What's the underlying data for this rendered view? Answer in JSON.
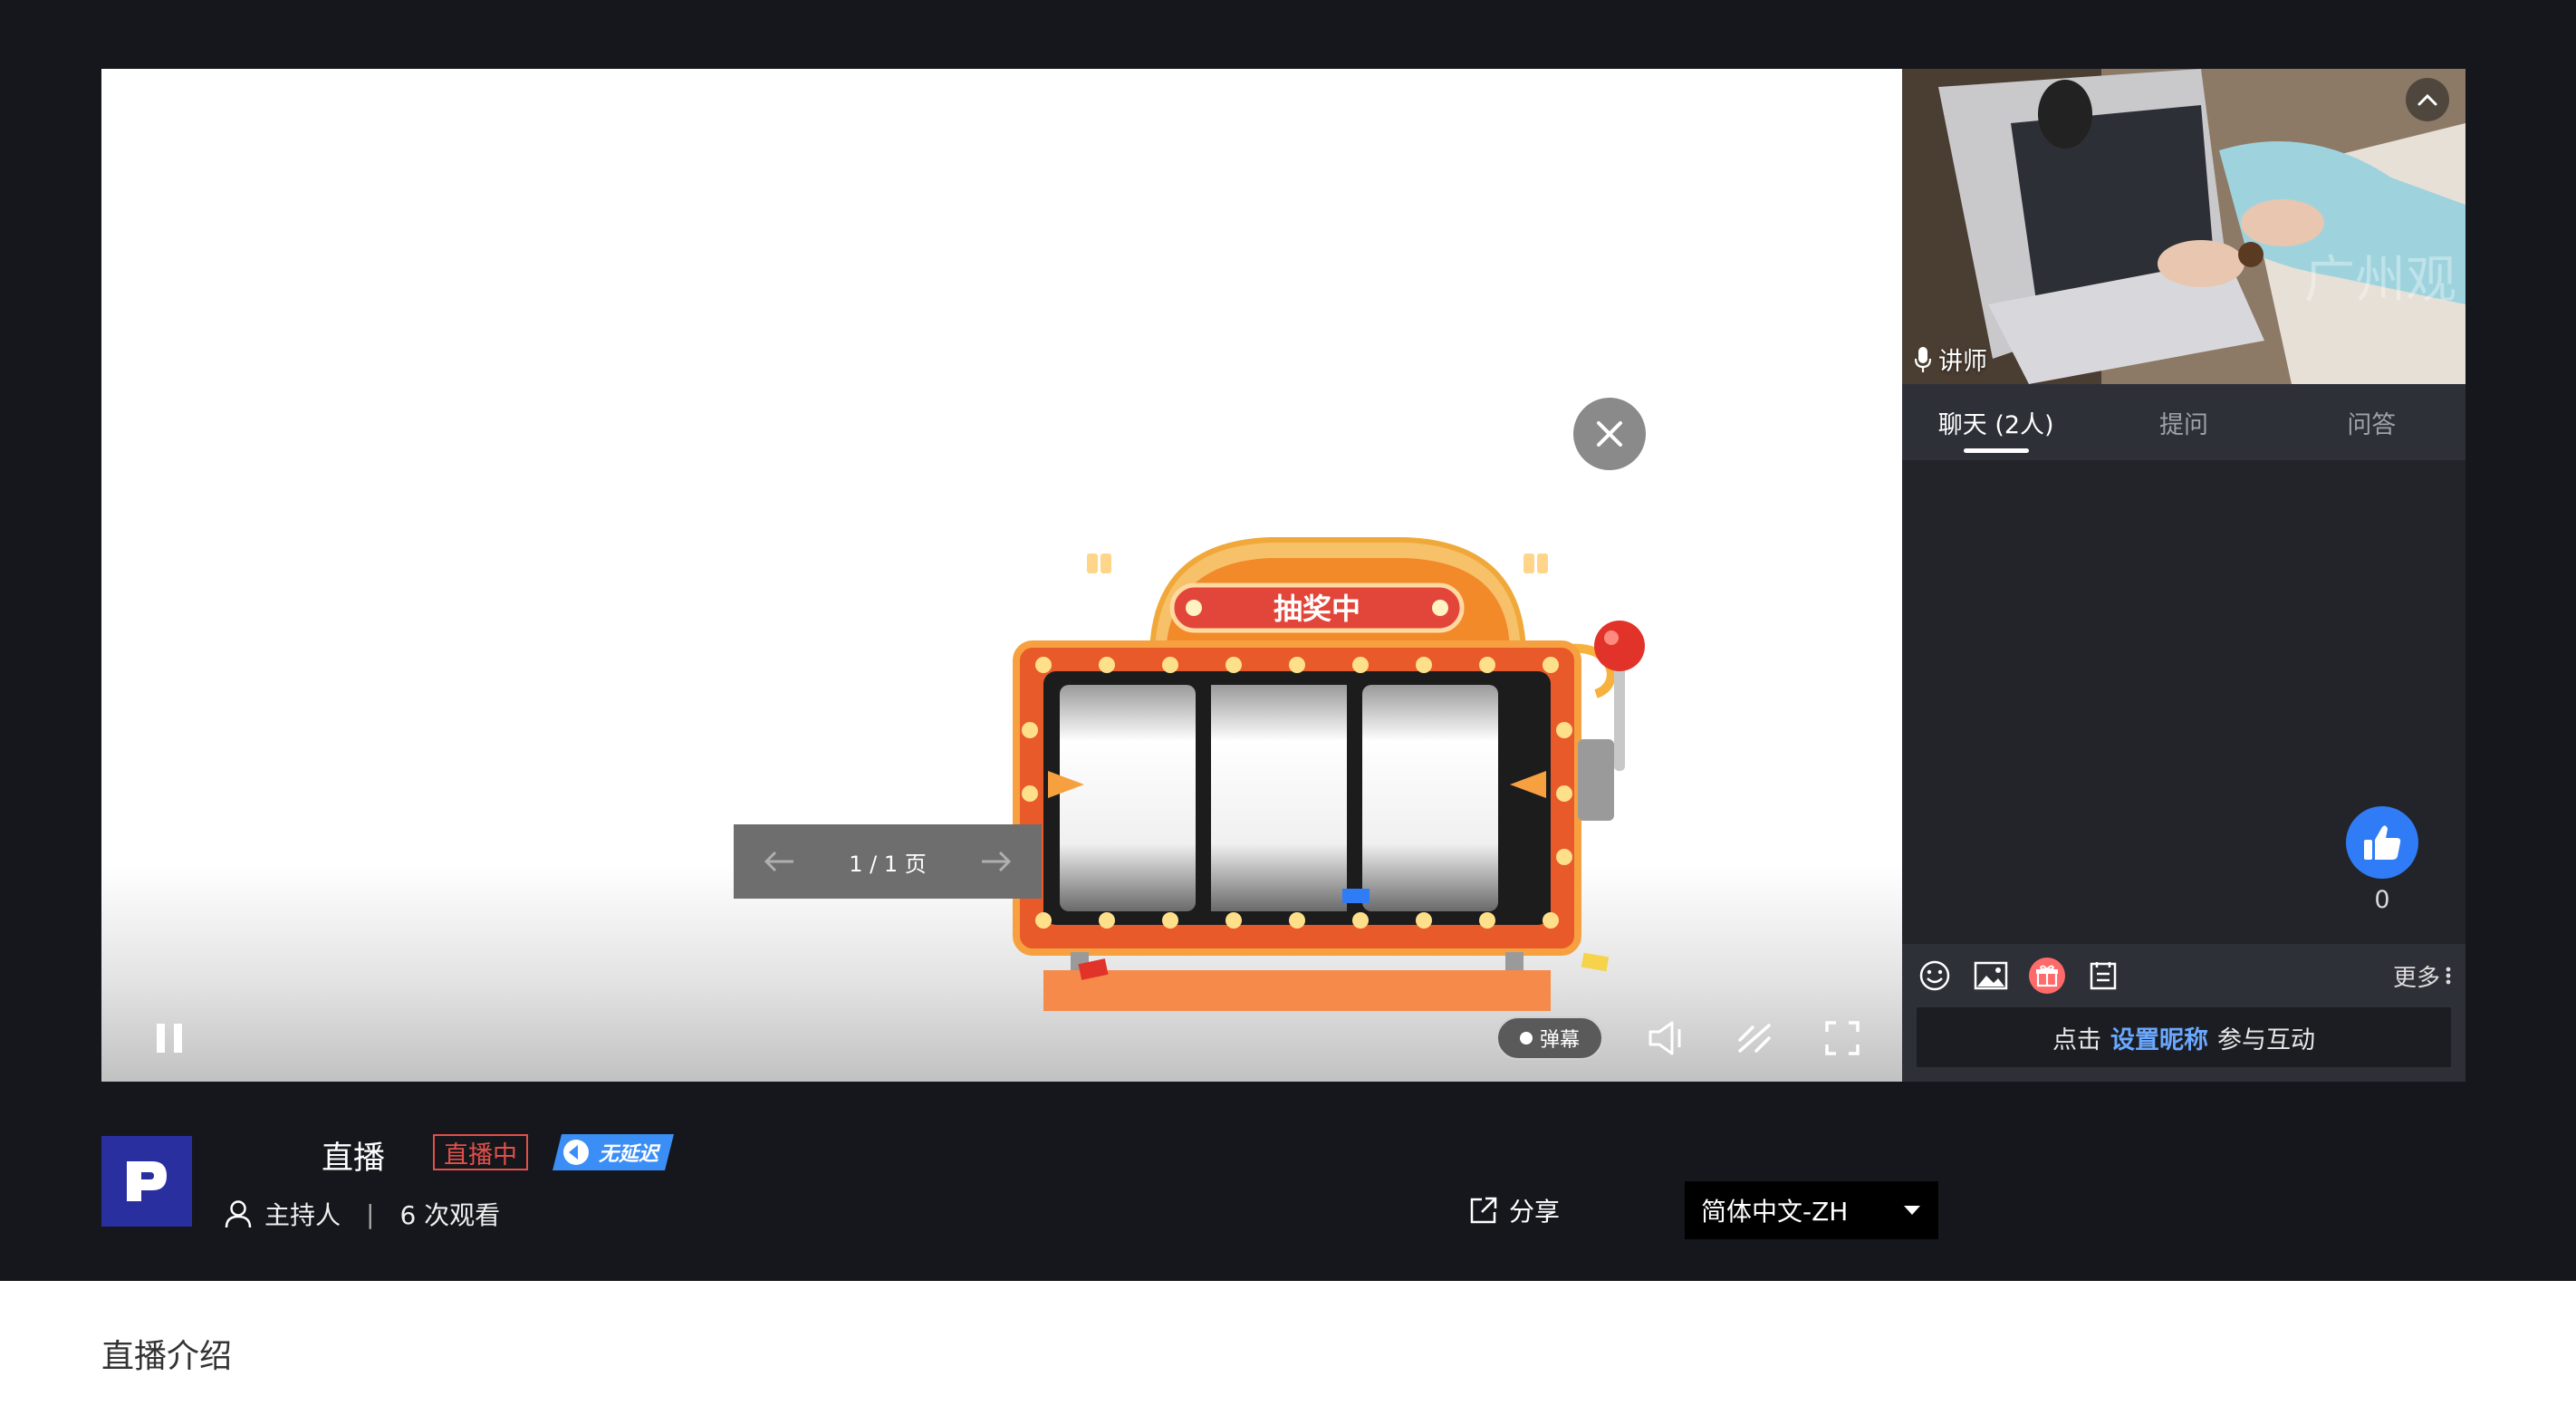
{
  "player": {
    "lottery_text": "抽奖中",
    "pager_text": "1 / 1 页",
    "danmu_label": "弹幕"
  },
  "sidebar": {
    "camera_label": "讲师",
    "camera_watermark": "广州观",
    "tabs": [
      {
        "label": "聊天 (2人)",
        "active": true
      },
      {
        "label": "提问",
        "active": false
      },
      {
        "label": "问答",
        "active": false
      }
    ],
    "like_count": "0",
    "more_label": "更多",
    "chat_prompt": {
      "before": "点击",
      "link": "设置昵称",
      "after": "参与互动"
    }
  },
  "info": {
    "title": "直播",
    "live_badge": "直播中",
    "nodelay_badge": "无延迟",
    "host": "主持人",
    "views": "6 次观看",
    "share_label": "分享",
    "language": "简体中文-ZH"
  },
  "intro": {
    "title": "直播介绍"
  },
  "colors": {
    "page_bg": "#15171c",
    "panel_bg": "#22242a",
    "accent_blue": "#2f7cf6",
    "live_red": "#e2504a",
    "logo_bg": "#2a2fa0"
  }
}
